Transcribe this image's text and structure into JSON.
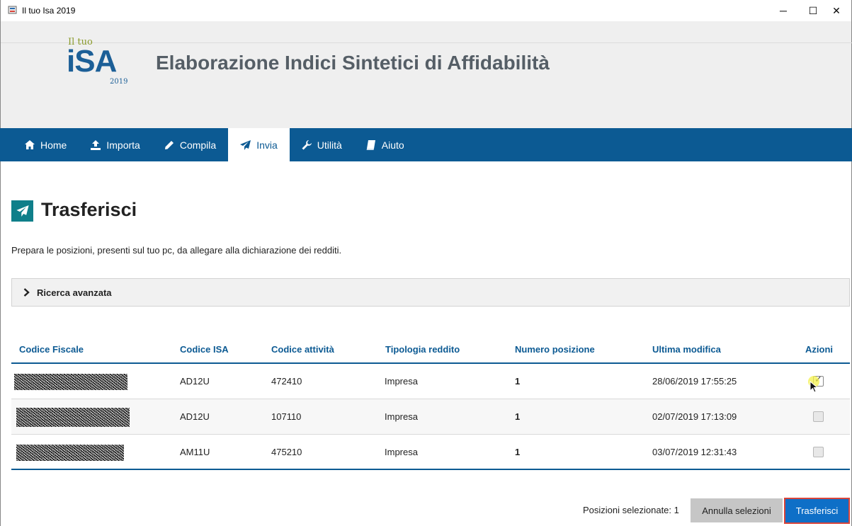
{
  "window": {
    "title": "Il tuo Isa 2019",
    "minimize_glyph": "─",
    "maximize_glyph": "☐",
    "close_glyph": "✕"
  },
  "header": {
    "logo_small": "Il tuo",
    "logo_big": "iSA",
    "logo_year": "2019",
    "heading": "Elaborazione Indici Sintetici di Affidabilità"
  },
  "nav": {
    "home": "Home",
    "importa": "Importa",
    "compila": "Compila",
    "invia": "Invia",
    "utilita": "Utilità",
    "aiuto": "Aiuto",
    "active": "invia",
    "icons": [
      "home-icon",
      "upload-icon",
      "pencil-icon",
      "paper-plane-icon",
      "wrench-icon",
      "book-icon"
    ]
  },
  "page": {
    "title": "Trasferisci",
    "description": "Prepara le posizioni, presenti sul tuo pc, da allegare alla dichiarazione dei redditi.",
    "advanced_search": "Ricerca avanzata"
  },
  "table": {
    "headers": {
      "codice_fiscale": "Codice Fiscale",
      "codice_isa": "Codice ISA",
      "codice_attivita": "Codice attività",
      "tipologia": "Tipologia reddito",
      "numero": "Numero posizione",
      "ultima": "Ultima modifica",
      "azioni": "Azioni"
    },
    "rows": [
      {
        "codice_isa": "AD12U",
        "codice_attivita": "472410",
        "tipologia": "Impresa",
        "numero": "1",
        "ultima": "28/06/2019 17:55:25",
        "selected": true
      },
      {
        "codice_isa": "AD12U",
        "codice_attivita": "107110",
        "tipologia": "Impresa",
        "numero": "1",
        "ultima": "02/07/2019 17:13:09",
        "selected": false
      },
      {
        "codice_isa": "AM11U",
        "codice_attivita": "475210",
        "tipologia": "Impresa",
        "numero": "1",
        "ultima": "03/07/2019 12:31:43",
        "selected": false
      }
    ]
  },
  "footer": {
    "selected_label": "Posizioni selezionate: 1",
    "cancel_button": "Annulla selezioni",
    "transfer_button": "Trasferisci"
  },
  "colors": {
    "nav_bg": "#0c5a93",
    "accent_teal": "#0f7f8a",
    "primary_button": "#0e6fc7",
    "highlight_border": "#d9443a"
  }
}
